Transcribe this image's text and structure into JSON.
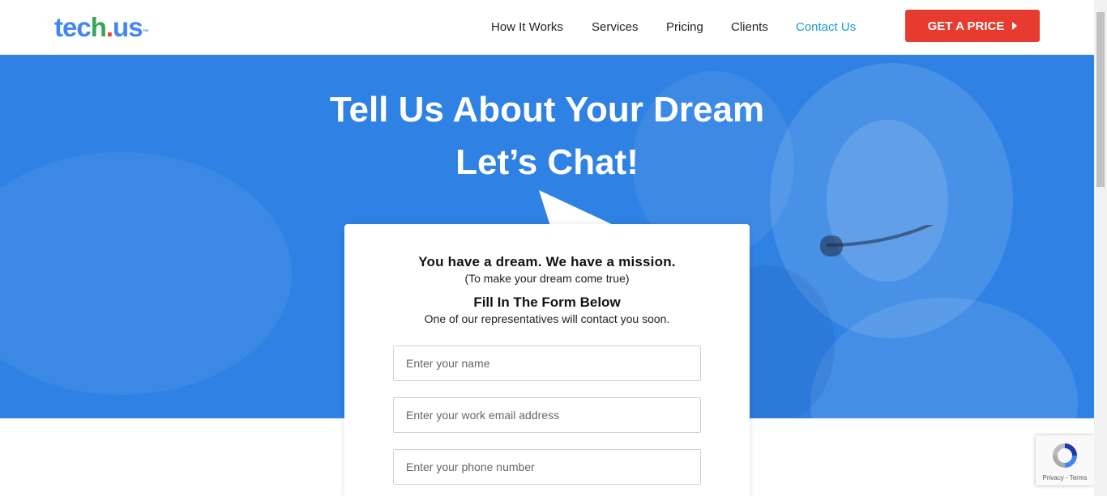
{
  "logo": {
    "part1": "tec",
    "part2": "h",
    "part3": ".",
    "part4": "us",
    "tm": "™"
  },
  "nav": {
    "items": [
      {
        "label": "How It Works"
      },
      {
        "label": "Services"
      },
      {
        "label": "Pricing"
      },
      {
        "label": "Clients"
      },
      {
        "label": "Contact Us"
      }
    ],
    "active": "Contact Us"
  },
  "cta": {
    "label": "GET A PRICE"
  },
  "hero": {
    "title_line1": "Tell Us About Your Dream",
    "title_line2": "Let’s Chat!"
  },
  "form": {
    "heading": "You have a dream. We have a mission.",
    "subheading": "(To make your dream come true)",
    "heading2": "Fill In The Form Below",
    "subheading2": "One of our representatives will contact you soon.",
    "name_placeholder": "Enter your name",
    "email_placeholder": "Enter your work email address",
    "phone_placeholder": "Enter your phone number"
  },
  "recaptcha": {
    "links": "Privacy - Terms"
  },
  "colors": {
    "hero": "#2f82e3",
    "cta": "#e63b2e",
    "active_nav": "#1a9ad6"
  }
}
